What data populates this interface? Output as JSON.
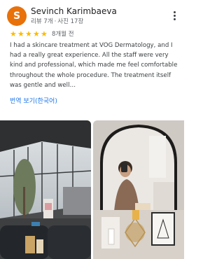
{
  "review": {
    "avatar_letter": "S",
    "reviewer_name": "Sevinch Karimbaeva",
    "reviews_count": "리뷰 7개",
    "separator": "·",
    "photos_count": "사진 17장",
    "star_rating": 5,
    "time_ago": "8개월 전",
    "text": "I had a skincare treatment at VOG Dermatology, and I had a really great experience. All the staff were very kind and professional, which made me feel comfortable throughout the whole procedure. The treatment itself was gentle and well…",
    "translate_label": "번역 보기(한국어)"
  },
  "colors": {
    "avatar_bg": "#e8710a",
    "star": "#fbbc04",
    "link": "#1a73e8"
  },
  "icons": {
    "more": "more-vert-icon",
    "star": "star-icon"
  }
}
